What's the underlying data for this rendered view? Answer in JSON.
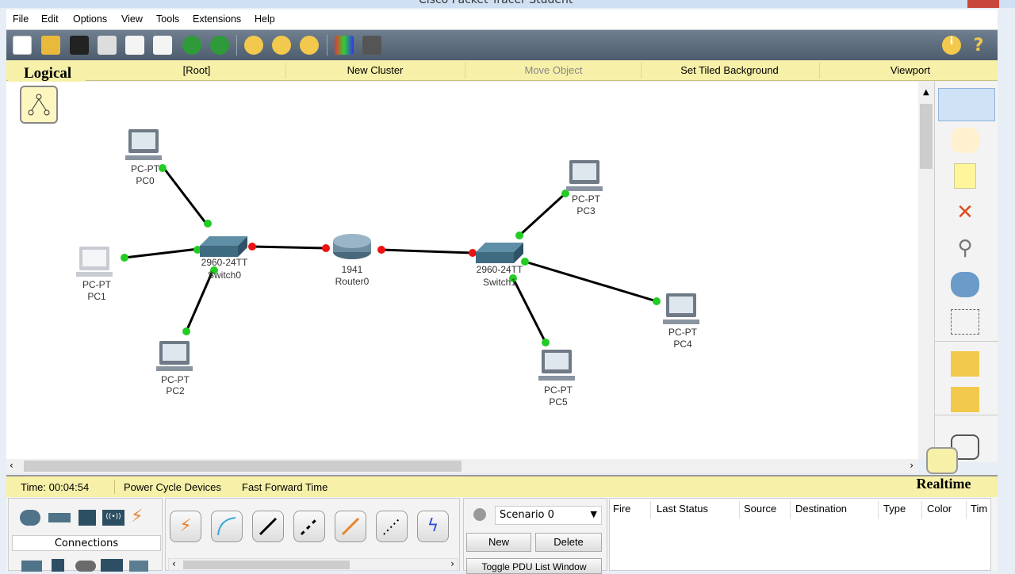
{
  "window": {
    "title": "Cisco Packet Tracer Student"
  },
  "menu": [
    "File",
    "Edit",
    "Options",
    "View",
    "Tools",
    "Extensions",
    "Help"
  ],
  "workspace_bar": {
    "tab": "Logical",
    "root": "[Root]",
    "new_cluster": "New Cluster",
    "move_object": "Move Object",
    "tiled_bg": "Set Tiled Background",
    "viewport": "Viewport"
  },
  "topology": {
    "devices": [
      {
        "id": "pc0",
        "model": "PC-PT",
        "name": "PC0"
      },
      {
        "id": "pc1",
        "model": "PC-PT",
        "name": "PC1"
      },
      {
        "id": "pc2",
        "model": "PC-PT",
        "name": "PC2"
      },
      {
        "id": "switch0",
        "model": "2960-24TT",
        "name": "Switch0"
      },
      {
        "id": "router0",
        "model": "1941",
        "name": "Router0"
      },
      {
        "id": "switch1",
        "model": "2960-24TT",
        "name": "Switch1"
      },
      {
        "id": "pc3",
        "model": "PC-PT",
        "name": "PC3"
      },
      {
        "id": "pc4",
        "model": "PC-PT",
        "name": "PC4"
      },
      {
        "id": "pc5",
        "model": "PC-PT",
        "name": "PC5"
      }
    ],
    "link_colors": {
      "up": "#22cc22",
      "down": "#ee1111"
    }
  },
  "status": {
    "time": "Time: 00:04:54",
    "power_cycle": "Power Cycle Devices",
    "fast_forward": "Fast Forward Time",
    "mode": "Realtime"
  },
  "device_panel": {
    "category_label": "Connections"
  },
  "scenario": {
    "selected": "Scenario 0",
    "new": "New",
    "delete": "Delete",
    "toggle": "Toggle PDU List Window"
  },
  "pdu_table": {
    "columns": [
      "Fire",
      "Last Status",
      "Source",
      "Destination",
      "Type",
      "Color",
      "Tim"
    ]
  },
  "icons": {
    "info": "info-icon",
    "help": "help-icon",
    "select": "select-icon",
    "hand": "hand-icon",
    "note": "note-icon",
    "delete": "delete-icon",
    "inspect": "inspect-icon"
  }
}
